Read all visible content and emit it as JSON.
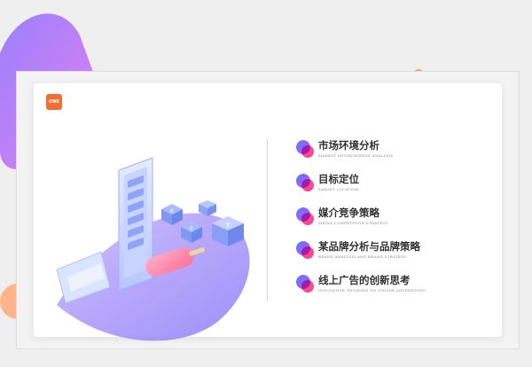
{
  "logo": {
    "text": "ONE"
  },
  "menu": {
    "items": [
      {
        "title": "市场环境分析",
        "subtitle": "MARKET ENVIRONMENT ANALYSIS"
      },
      {
        "title": "目标定位",
        "subtitle": "TARGET LOCATION"
      },
      {
        "title": "媒介竞争策略",
        "subtitle": "MEDIA COMPETITION STRATEGY"
      },
      {
        "title": "某品牌分析与品牌策略",
        "subtitle": "BRAND ANALYSIS AND BRAND STRATEGY"
      },
      {
        "title": "线上广告的创新思考",
        "subtitle": "INNOVATIVE THINKING ON ONLINE ADVERTISING"
      }
    ]
  },
  "illustration": {
    "cube_letters": [
      "K",
      "E",
      "Y"
    ]
  },
  "colors": {
    "accent_purple": "#a05cff",
    "accent_pink": "#ff4fa0",
    "logo_orange": "#f26c33",
    "deco_orange": "#ffb48a",
    "deco_teal": "#3cc9d6"
  }
}
